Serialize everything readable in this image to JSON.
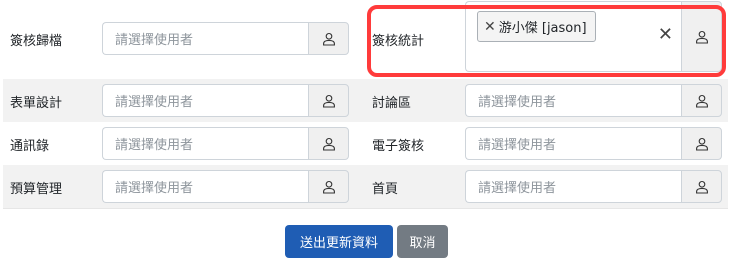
{
  "placeholder": "請選擇使用者",
  "rows": [
    {
      "left_label": "簽核歸檔",
      "right_label": "簽核統計"
    },
    {
      "left_label": "表單設計",
      "right_label": "討論區"
    },
    {
      "left_label": "通訊錄",
      "right_label": "電子簽核"
    },
    {
      "left_label": "預算管理",
      "right_label": "首頁"
    }
  ],
  "selected_tag": {
    "remove_glyph": "✕",
    "label": "游小傑 [jason]"
  },
  "clear_glyph": "✕",
  "buttons": {
    "submit": "送出更新資料",
    "cancel": "取消"
  },
  "icons": {
    "user": "user-icon",
    "remove": "close-icon",
    "clear": "clear-icon"
  },
  "colors": {
    "highlight": "#ff3b3b",
    "primary": "#1f5db4",
    "secondary": "#737b83"
  }
}
